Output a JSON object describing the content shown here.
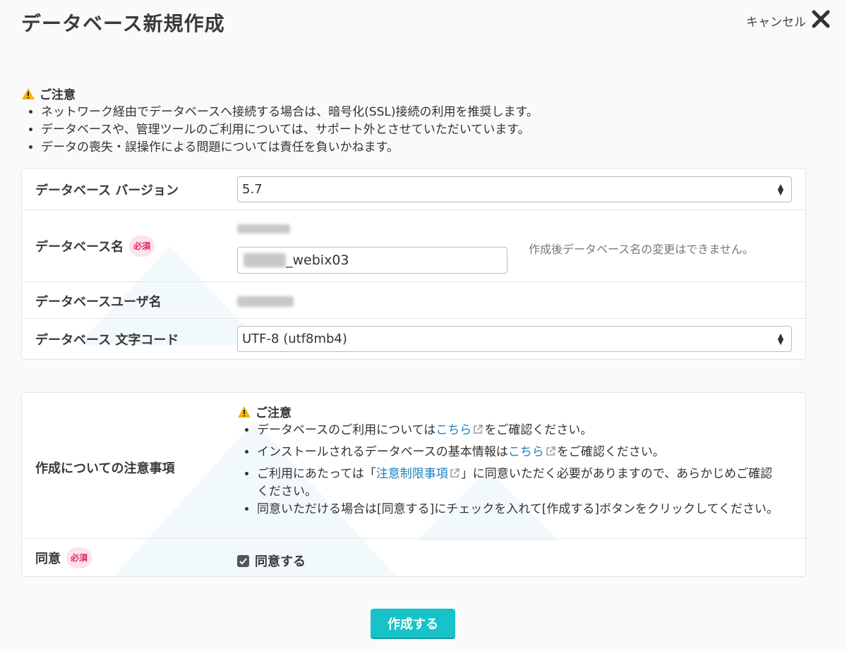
{
  "header": {
    "title": "データベース新規作成",
    "cancel_label": "キャンセル"
  },
  "top_notice": {
    "heading": "ご注意",
    "items": [
      "ネットワーク経由でデータベースへ接続する場合は、暗号化(SSL)接続の利用を推奨します。",
      "データベースや、管理ツールのご利用については、サポート外とさせていただいています。",
      "データの喪失・誤操作による問題については責任を負いかねます。"
    ]
  },
  "form": {
    "version_label": "データベース バージョン",
    "version_value": "5.7",
    "db_name_label": "データベース名",
    "db_name_suffix": "_webix03",
    "db_name_hint": "作成後データベース名の変更はできません。",
    "db_user_label": "データベースユーザ名",
    "charset_label": "データベース 文字コード",
    "charset_value": "UTF-8 (utf8mb4)",
    "required_badge": "必須"
  },
  "notes_section": {
    "label": "作成についての注意事項",
    "heading": "ご注意",
    "item1_pre": "データベースのご利用については",
    "item1_link": "こちら",
    "item1_post": "をご確認ください。",
    "item2_pre": "インストールされるデータベースの基本情報は",
    "item2_link": "こちら",
    "item2_post": "をご確認ください。",
    "item3_pre": "ご利用にあたっては「",
    "item3_link": "注意制限事項",
    "item3_post": "」に同意いただく必要がありますので、あらかじめご確認ください。",
    "item4": "同意いただける場合は[同意する]にチェックを入れて[作成する]ボタンをクリックしてください。"
  },
  "agree": {
    "label": "同意",
    "required_badge": "必須",
    "checkbox_label": "同意する",
    "checked": true
  },
  "submit": {
    "label": "作成する"
  },
  "colors": {
    "accent": "#17c3c8",
    "required": "#e0245e",
    "link": "#1a7fc1"
  },
  "icons": [
    "close-icon",
    "warning-icon",
    "external-link-icon",
    "checkbox-icon",
    "select-arrows-icon"
  ]
}
